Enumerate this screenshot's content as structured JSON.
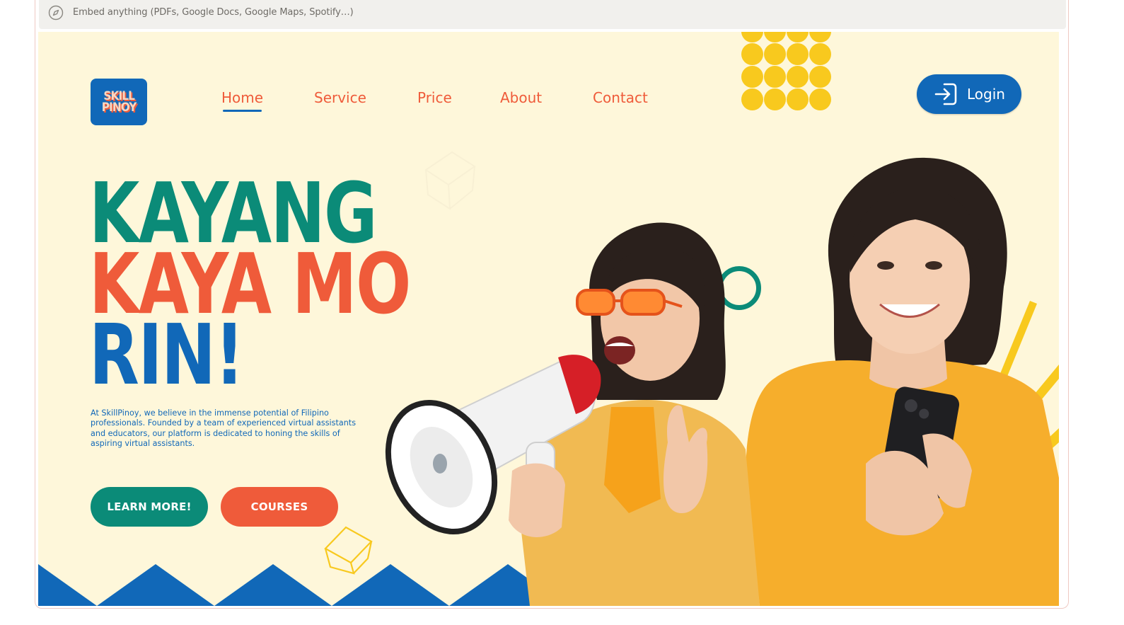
{
  "embed_bar": {
    "placeholder": "Embed anything (PDFs, Google Docs, Google Maps, Spotify…)",
    "icon": "compass-icon"
  },
  "brand": {
    "logo_line1": "SKILL",
    "logo_line2": "PINOY"
  },
  "nav": {
    "items": [
      {
        "label": "Home",
        "active": true
      },
      {
        "label": "Service"
      },
      {
        "label": "Price"
      },
      {
        "label": "About"
      },
      {
        "label": "Contact"
      }
    ],
    "login_label": "Login",
    "login_icon": "login-arrow-icon"
  },
  "hero": {
    "headline_line1": "KAYANG",
    "headline_line2": "KAYA MO",
    "headline_line3": "RIN!",
    "description": "At SkillPinoy, we believe in the immense potential of Filipino professionals. Founded by a team of experienced virtual assistants and educators, our platform is dedicated to honing the skills of aspiring virtual assistants.",
    "primary_cta": "LEARN MORE!",
    "secondary_cta": "COURSES"
  },
  "colors": {
    "background": "#fef7da",
    "teal": "#0b8b78",
    "coral": "#ef5b3a",
    "blue": "#1168b8",
    "yellow": "#f8c91e"
  }
}
